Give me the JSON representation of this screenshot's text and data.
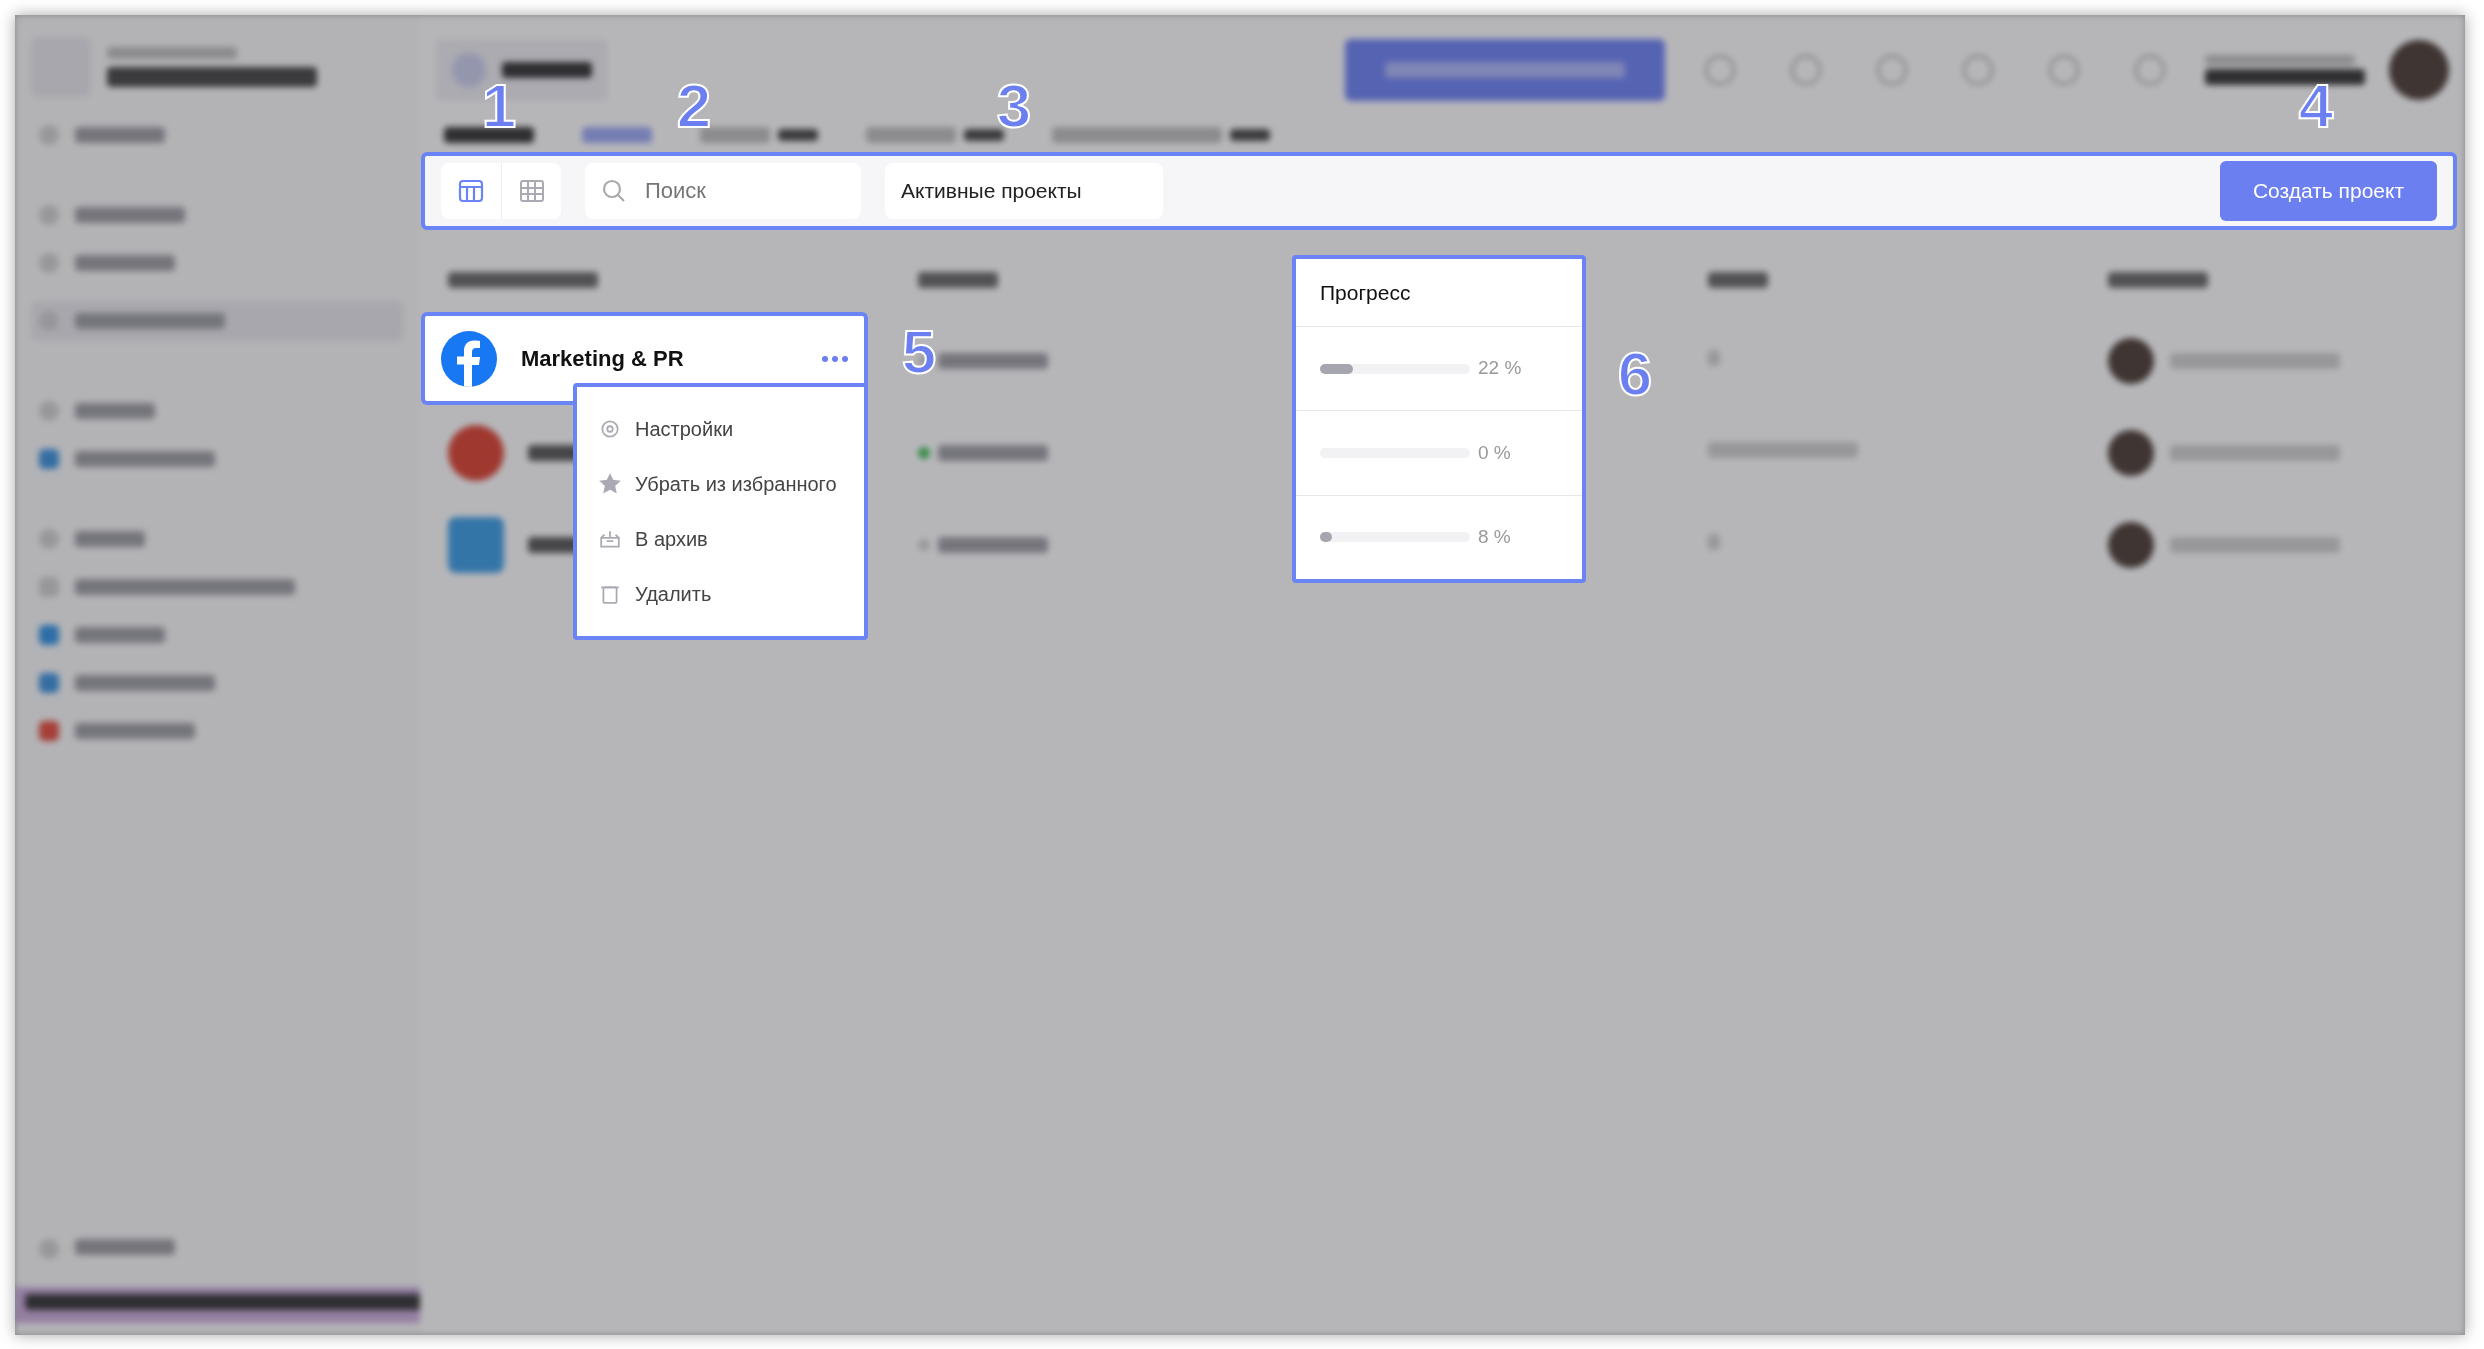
{
  "toolbar": {
    "views": [
      {
        "kind": "board",
        "selected": true
      },
      {
        "kind": "table",
        "selected": false
      }
    ],
    "search": {
      "placeholder": "Поиск"
    },
    "filter": "Активные проекты",
    "create_button": "Создать проект"
  },
  "project_row": {
    "name": "Marketing & PR"
  },
  "row_menu": [
    {
      "kind": "settings",
      "label": "Настройки"
    },
    {
      "kind": "star",
      "label": "Убрать из избранного"
    },
    {
      "kind": "archive",
      "label": "В архив"
    },
    {
      "kind": "trash",
      "label": "Удалить"
    }
  ],
  "progress": {
    "title": "Прогресс",
    "rows": [
      {
        "level": 0.22,
        "reading": "22 %"
      },
      {
        "level": 0,
        "reading": "0 %"
      },
      {
        "level": 0.08,
        "reading": "8 %"
      }
    ]
  },
  "callouts": [
    "1",
    "2",
    "3",
    "4",
    "5",
    "6"
  ]
}
